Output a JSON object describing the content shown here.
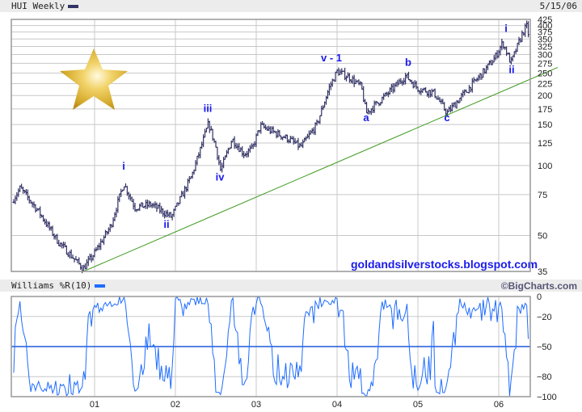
{
  "header": {
    "title": "HUI Weekly",
    "date": "5/15/06",
    "legend_color": "#333366"
  },
  "indicator_header": {
    "title": "Williams %R(10)",
    "legend_color": "#1e6cff",
    "credit": "©BigCharts.com"
  },
  "watermark": "goldandsilverstocks.blogspot.com",
  "chart_data": [
    {
      "type": "line",
      "title": "HUI Weekly",
      "scale": "log",
      "ylim": [
        35,
        425
      ],
      "yticks": [
        35,
        50,
        75,
        100,
        125,
        150,
        175,
        200,
        225,
        250,
        275,
        300,
        325,
        350,
        375,
        400,
        425
      ],
      "xticks": [
        {
          "label": "01",
          "t": 2001
        },
        {
          "label": "02",
          "t": 2002
        },
        {
          "label": "03",
          "t": 2003
        },
        {
          "label": "04",
          "t": 2004
        },
        {
          "label": "05",
          "t": 2005
        },
        {
          "label": "06",
          "t": 2006
        }
      ],
      "xlim": [
        2000.0,
        2006.38
      ],
      "series": [
        {
          "name": "HUI weekly (approx. closes, OHLC bars)",
          "color": "#333366",
          "points": [
            [
              2000.0,
              72
            ],
            [
              2000.08,
              80
            ],
            [
              2000.3,
              64
            ],
            [
              2000.55,
              47
            ],
            [
              2000.86,
              36
            ],
            [
              2001.0,
              42
            ],
            [
              2001.2,
              55
            ],
            [
              2001.36,
              84
            ],
            [
              2001.5,
              66
            ],
            [
              2001.7,
              68
            ],
            [
              2001.95,
              60
            ],
            [
              2002.2,
              90
            ],
            [
              2002.3,
              115
            ],
            [
              2002.41,
              152
            ],
            [
              2002.5,
              120
            ],
            [
              2002.56,
              95
            ],
            [
              2002.7,
              130
            ],
            [
              2002.85,
              112
            ],
            [
              2002.95,
              118
            ],
            [
              2003.05,
              148
            ],
            [
              2003.2,
              140
            ],
            [
              2003.4,
              130
            ],
            [
              2003.55,
              120
            ],
            [
              2003.75,
              150
            ],
            [
              2003.9,
              215
            ],
            [
              2004.0,
              254
            ],
            [
              2004.15,
              240
            ],
            [
              2004.3,
              218
            ],
            [
              2004.36,
              168
            ],
            [
              2004.6,
              200
            ],
            [
              2004.85,
              243
            ],
            [
              2005.0,
              215
            ],
            [
              2005.2,
              205
            ],
            [
              2005.36,
              168
            ],
            [
              2005.55,
              200
            ],
            [
              2005.8,
              250
            ],
            [
              2005.95,
              290
            ],
            [
              2006.05,
              338
            ],
            [
              2006.15,
              276
            ],
            [
              2006.3,
              375
            ],
            [
              2006.35,
              398
            ],
            [
              2006.38,
              345
            ]
          ]
        }
      ],
      "trendline": {
        "color": "#3a9a1a",
        "from": [
          2000.86,
          35
        ],
        "to": [
          2006.39,
          235
        ]
      },
      "annotations": [
        {
          "text": "i",
          "t": 2001.36,
          "v": 96
        },
        {
          "text": "ii",
          "t": 2001.89,
          "v": 54
        },
        {
          "text": "iii",
          "t": 2002.4,
          "v": 170
        },
        {
          "text": "iv",
          "t": 2002.55,
          "v": 86
        },
        {
          "text": "v - 1",
          "t": 2003.93,
          "v": 280
        },
        {
          "text": "a",
          "t": 2004.36,
          "v": 155
        },
        {
          "text": "b",
          "t": 2004.88,
          "v": 268
        },
        {
          "text": "c",
          "t": 2005.36,
          "v": 155
        },
        {
          "text": "i",
          "t": 2006.09,
          "v": 375
        },
        {
          "text": "ii",
          "t": 2006.16,
          "v": 250
        }
      ]
    },
    {
      "type": "line",
      "title": "Williams %R(10)",
      "ylim": [
        -100,
        0
      ],
      "yticks": [
        0,
        -20,
        -50,
        -80,
        -100
      ],
      "reference_line": -50,
      "series": [
        {
          "name": "Williams %R(10)",
          "color": "#1e6cff",
          "derived_from": "HUI weekly, 10-period"
        }
      ]
    }
  ]
}
